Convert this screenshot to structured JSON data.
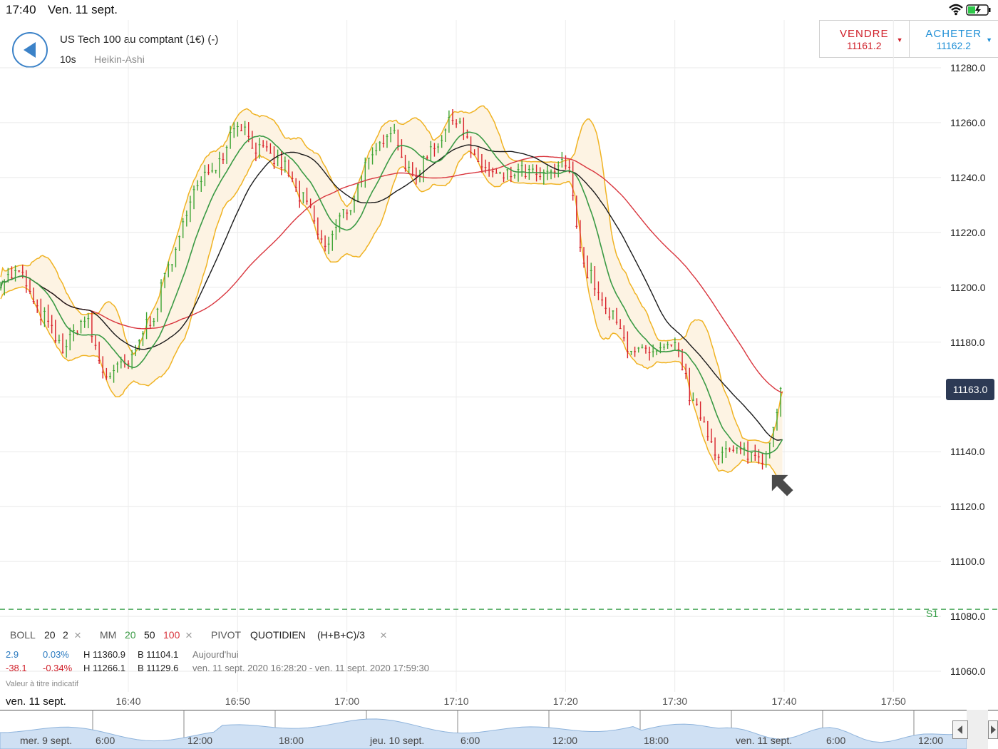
{
  "status_bar": {
    "time": "17:40",
    "date": "Ven. 11 sept."
  },
  "instrument": {
    "name": "US Tech 100 au comptant (1€) (-)",
    "interval": "10s",
    "candle_type": "Heikin-Ashi"
  },
  "trade": {
    "sell_label": "VENDRE",
    "sell_price": "11161.2",
    "buy_label": "ACHETER",
    "buy_price": "11162.2"
  },
  "price_axis": {
    "ticks": [
      "11280.0",
      "11260.0",
      "11240.0",
      "11220.0",
      "11200.0",
      "11180.0",
      "11140.0",
      "11120.0",
      "11100.0",
      "11080.0",
      "11060.0"
    ],
    "current_price": "11163.0",
    "support_label": "S1"
  },
  "time_axis": {
    "date_label": "ven. 11 sept.",
    "ticks": [
      "16:40",
      "16:50",
      "17:00",
      "17:10",
      "17:20",
      "17:30",
      "17:40",
      "17:50"
    ]
  },
  "indicators": {
    "boll": {
      "name": "BOLL",
      "p1": "20",
      "p2": "2"
    },
    "mm": {
      "name": "MM",
      "p1": "20",
      "p2": "50",
      "p3": "100"
    },
    "pivot": {
      "name": "PIVOT",
      "period": "QUOTIDIEN",
      "formula": "(H+B+C)/3"
    },
    "close": "×"
  },
  "stats": {
    "row1": {
      "change": "2.9",
      "pct": "0.03%",
      "high": "H 11360.9",
      "low": "B 11104.1",
      "range": "Aujourd'hui"
    },
    "row2": {
      "change": "-38.1",
      "pct": "-0.34%",
      "high": "H 11266.1",
      "low": "B 11129.6",
      "range": "ven. 11 sept. 2020 16:28:20 - ven. 11 sept. 2020 17:59:30"
    }
  },
  "disclaimer": "Valeur à titre indicatif",
  "navigator": {
    "labels": [
      "mer. 9 sept.",
      "6:00",
      "12:00",
      "18:00",
      "jeu. 10 sept.",
      "6:00",
      "12:00",
      "18:00",
      "ven. 11 sept.",
      "6:00",
      "12:00"
    ]
  },
  "colors": {
    "bull": "#3fa535",
    "bear": "#d8222b",
    "boll": "#f0b323",
    "band_fill": "#fdf3e3",
    "ma20": "#3a9a44",
    "ma50": "#1a1a1a",
    "ma100": "#d9363e",
    "accent": "#3b82c8",
    "price_tag": "#2d3a55",
    "support": "#2e9a40"
  },
  "chart_data": {
    "type": "candlestick",
    "y_range": [
      11060,
      11280
    ],
    "x_range": [
      "16:28:20",
      "17:55:00"
    ],
    "current_price": 11163.0,
    "support_S1": 11080,
    "close_series": [
      [
        "16:28",
        11202
      ],
      [
        "16:30",
        11205
      ],
      [
        "16:32",
        11190
      ],
      [
        "16:34",
        11178
      ],
      [
        "16:36",
        11188
      ],
      [
        "16:38",
        11168
      ],
      [
        "16:40",
        11172
      ],
      [
        "16:42",
        11188
      ],
      [
        "16:44",
        11210
      ],
      [
        "16:46",
        11235
      ],
      [
        "16:48",
        11245
      ],
      [
        "16:50",
        11260
      ],
      [
        "16:52",
        11250
      ],
      [
        "16:54",
        11245
      ],
      [
        "16:56",
        11232
      ],
      [
        "16:58",
        11215
      ],
      [
        "17:00",
        11228
      ],
      [
        "17:02",
        11245
      ],
      [
        "17:04",
        11258
      ],
      [
        "17:06",
        11240
      ],
      [
        "17:08",
        11252
      ],
      [
        "17:10",
        11262
      ],
      [
        "17:12",
        11245
      ],
      [
        "17:14",
        11240
      ],
      [
        "17:16",
        11242
      ],
      [
        "17:18",
        11240
      ],
      [
        "17:20",
        11245
      ],
      [
        "17:22",
        11205
      ],
      [
        "17:24",
        11190
      ],
      [
        "17:26",
        11178
      ],
      [
        "17:28",
        11175
      ],
      [
        "17:30",
        11178
      ],
      [
        "17:32",
        11155
      ],
      [
        "17:34",
        11140
      ],
      [
        "17:36",
        11140
      ],
      [
        "17:38",
        11138
      ],
      [
        "17:40",
        11163
      ]
    ]
  }
}
